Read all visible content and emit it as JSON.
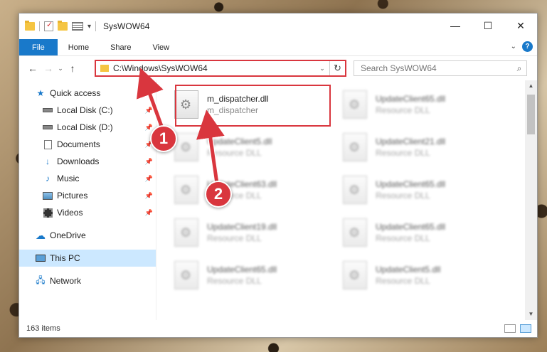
{
  "window": {
    "title": "SysWOW64"
  },
  "ribbon": {
    "tabs": [
      "File",
      "Home",
      "Share",
      "View"
    ],
    "help": "?"
  },
  "nav": {
    "address": "C:\\Windows\\SysWOW64",
    "search_placeholder": "Search SysWOW64"
  },
  "sidebar": {
    "quick_access": "Quick access",
    "items": [
      {
        "label": "Local Disk (C:)",
        "icon": "drive-icon"
      },
      {
        "label": "Local Disk (D:)",
        "icon": "drive-icon"
      },
      {
        "label": "Documents",
        "icon": "documents-icon"
      },
      {
        "label": "Downloads",
        "icon": "downloads-icon"
      },
      {
        "label": "Music",
        "icon": "music-icon"
      },
      {
        "label": "Pictures",
        "icon": "pictures-icon"
      },
      {
        "label": "Videos",
        "icon": "videos-icon"
      }
    ],
    "onedrive": "OneDrive",
    "this_pc": "This PC",
    "network": "Network"
  },
  "files": {
    "highlighted": {
      "name": "m_dispatcher.dll",
      "type": "m_dispatcher"
    },
    "blurred": [
      {
        "name": "UpdateClient65.dll",
        "type": "Resource DLL"
      },
      {
        "name": "UpdateClient5.dll",
        "type": "Resource DLL"
      },
      {
        "name": "UpdateClient21.dll",
        "type": "Resource DLL"
      },
      {
        "name": "UpdateClient63.dll",
        "type": "Resource DLL"
      },
      {
        "name": "UpdateClient65.dll",
        "type": "Resource DLL"
      },
      {
        "name": "UpdateClient19.dll",
        "type": "Resource DLL"
      },
      {
        "name": "UpdateClient65.dll",
        "type": "Resource DLL"
      },
      {
        "name": "UpdateClient65.dll",
        "type": "Resource DLL"
      },
      {
        "name": "UpdateClient5.dll",
        "type": "Resource DLL"
      }
    ]
  },
  "status": {
    "item_count": "163 items"
  },
  "annotations": {
    "step1": "1",
    "step2": "2",
    "color": "#d9363e"
  }
}
